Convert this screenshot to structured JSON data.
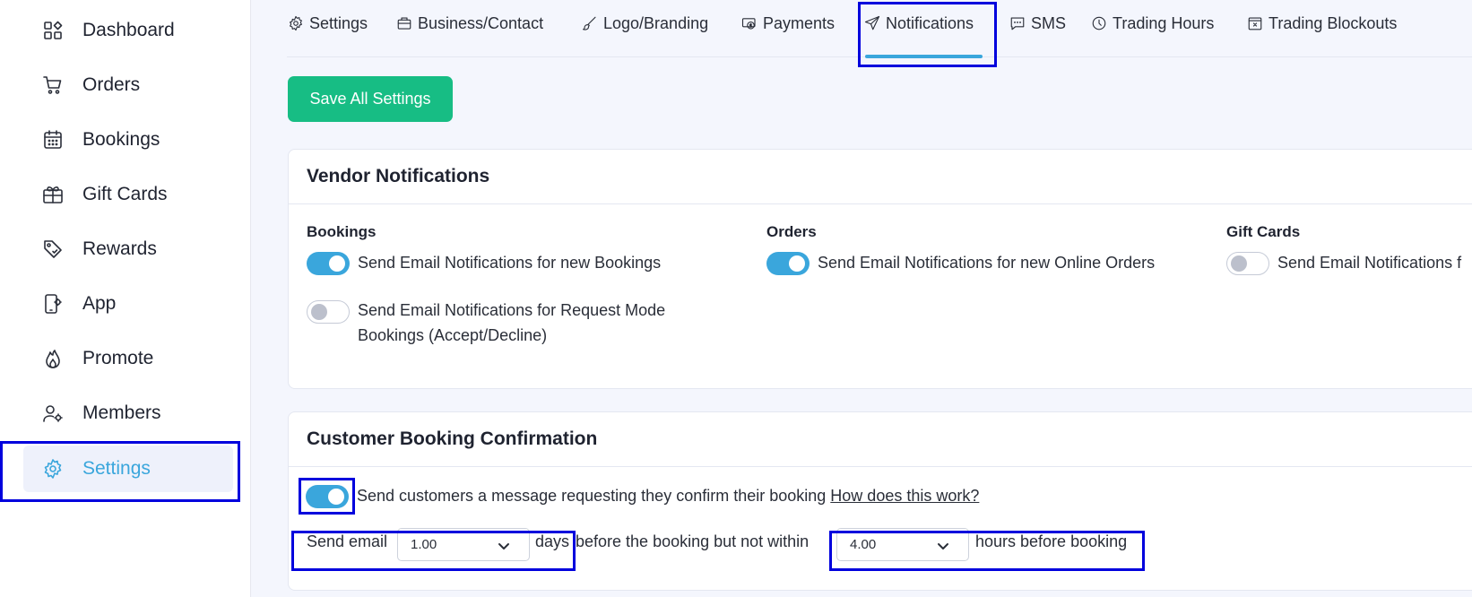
{
  "sidebar": {
    "items": [
      {
        "label": "Dashboard",
        "icon": "dashboard-icon"
      },
      {
        "label": "Orders",
        "icon": "cart-icon"
      },
      {
        "label": "Bookings",
        "icon": "calendar-icon"
      },
      {
        "label": "Gift Cards",
        "icon": "gift-card-icon"
      },
      {
        "label": "Rewards",
        "icon": "tag-icon"
      },
      {
        "label": "App",
        "icon": "phone-settings-icon"
      },
      {
        "label": "Promote",
        "icon": "flame-icon"
      },
      {
        "label": "Members",
        "icon": "user-gear-icon"
      },
      {
        "label": "Settings",
        "icon": "gear-icon",
        "active": true
      }
    ]
  },
  "tabs": [
    {
      "label": "Settings",
      "icon": "gear-icon"
    },
    {
      "label": "Business/Contact",
      "icon": "briefcase-icon"
    },
    {
      "label": "Logo/Branding",
      "icon": "brush-icon"
    },
    {
      "label": "Payments",
      "icon": "money-icon"
    },
    {
      "label": "Notifications",
      "icon": "send-icon",
      "active": true
    },
    {
      "label": "SMS",
      "icon": "message-icon"
    },
    {
      "label": "Trading Hours",
      "icon": "clock-icon"
    },
    {
      "label": "Trading Blockouts",
      "icon": "calendar-x-icon"
    }
  ],
  "toolbar": {
    "save_label": "Save All Settings"
  },
  "vendor": {
    "title": "Vendor Notifications",
    "bookings": {
      "title": "Bookings",
      "new_label": "Send Email Notifications for new Bookings",
      "new_on": true,
      "request_label_1": "Send Email Notifications for Request Mode",
      "request_label_2": "Bookings (Accept/Decline)",
      "request_on": false
    },
    "orders": {
      "title": "Orders",
      "label": "Send Email Notifications for new Online Orders",
      "on": true
    },
    "giftcards": {
      "title": "Gift Cards",
      "label": "Send Email Notifications f",
      "on": false
    }
  },
  "customer": {
    "title": "Customer Booking Confirmation",
    "confirm_label": "Send customers a message requesting they confirm their booking",
    "confirm_on": true,
    "help_link": "How does this work?",
    "send_email": "Send email",
    "days_value": "1.00",
    "days": "days",
    "before_text": "before the booking but not within",
    "hours_value": "4.00",
    "hours_text": "hours before booking"
  },
  "colors": {
    "accent": "#3aa6dc",
    "save": "#17bd84",
    "highlight": "#0000dd"
  }
}
